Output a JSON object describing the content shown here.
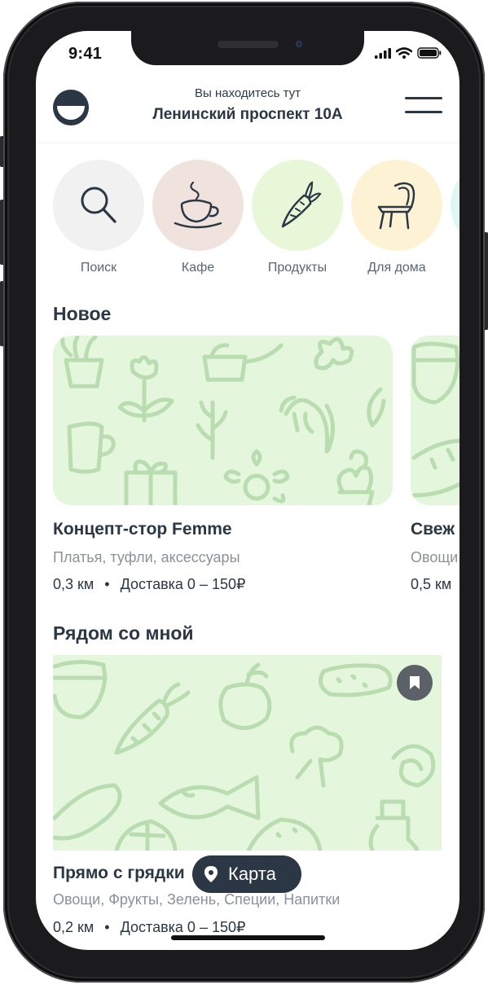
{
  "status_bar": {
    "time": "9:41"
  },
  "header": {
    "caption": "Вы находитесь тут",
    "address": "Ленинский проспект 10А"
  },
  "categories": [
    {
      "label": "Поиск",
      "icon": "search-icon",
      "color": "#f1f1f2"
    },
    {
      "label": "Кафе",
      "icon": "coffee-cup-icon",
      "color": "#f0e3de"
    },
    {
      "label": "Продукты",
      "icon": "carrot-icon",
      "color": "#e7f7d7"
    },
    {
      "label": "Для дома",
      "icon": "chair-icon",
      "color": "#fdf3d4"
    },
    {
      "label": "",
      "icon": "category-icon",
      "color": "#dff7f1"
    }
  ],
  "sections": {
    "new_title": "Новое",
    "nearby_title": "Рядом со мной"
  },
  "new_cards": [
    {
      "title": "Концепт-стор Femme",
      "subtitle": "Платья, туфли, аксессуары",
      "distance": "0,3 км",
      "delivery": "Доставка 0 – 150₽"
    },
    {
      "title": "Свеж",
      "subtitle": "Овощи",
      "distance": "0,5 км",
      "delivery": ""
    }
  ],
  "nearby_cards": [
    {
      "title": "Прямо с грядки",
      "subtitle": "Овощи, Фрукты, Зелень, Специи, Напитки",
      "distance": "0,2 км",
      "delivery": "Доставка 0 – 150₽"
    }
  ],
  "meta_separator": "•",
  "map_button": {
    "label": "Карта"
  },
  "colors": {
    "accent": "#2b3744",
    "card_bg": "#e4f7dc",
    "doodle": "#b9dcb0"
  }
}
